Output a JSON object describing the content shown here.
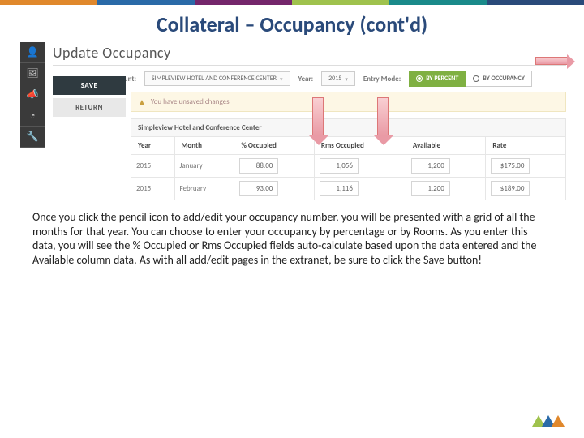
{
  "brandColors": [
    "#e0882c",
    "#2a6aa8",
    "#74266b",
    "#9fc24d",
    "#1a8a8a",
    "#2a4a7a"
  ],
  "slide": {
    "title": "Collateral – Occupancy (cont'd)"
  },
  "app": {
    "title": "Update Occupancy",
    "filters": {
      "account_label": "Account:",
      "account_value": "SIMPLEVIEW HOTEL AND CONFERENCE CENTER",
      "year_label": "Year:",
      "year_value": "2015",
      "mode_label": "Entry Mode:",
      "mode_percent": "BY PERCENT",
      "mode_occupancy": "BY OCCUPANCY"
    },
    "buttons": {
      "save": "SAVE",
      "return": "RETURN"
    },
    "warning": "You have unsaved changes",
    "table": {
      "title": "Simpleview Hotel and Conference Center",
      "headers": {
        "year": "Year",
        "month": "Month",
        "pct": "% Occupied",
        "rms": "Rms Occupied",
        "avail": "Available",
        "rate": "Rate"
      },
      "rows": [
        {
          "year": "2015",
          "month": "January",
          "pct": "88.00",
          "rms": "1,056",
          "avail": "1,200",
          "rate": "$175.00"
        },
        {
          "year": "2015",
          "month": "February",
          "pct": "93.00",
          "rms": "1,116",
          "avail": "1,200",
          "rate": "$189.00"
        }
      ]
    }
  },
  "body": "Once you click the pencil icon to add/edit your occupancy number, you will be presented with a grid of all the months for that year.  You can choose to enter your occupancy by percentage or by Rooms.  As you enter this data, you will see the % Occupied or Rms Occupied fields auto-calculate based upon the data entered and the Available column data.  As with all add/edit pages in the extranet, be sure to click the Save button!"
}
